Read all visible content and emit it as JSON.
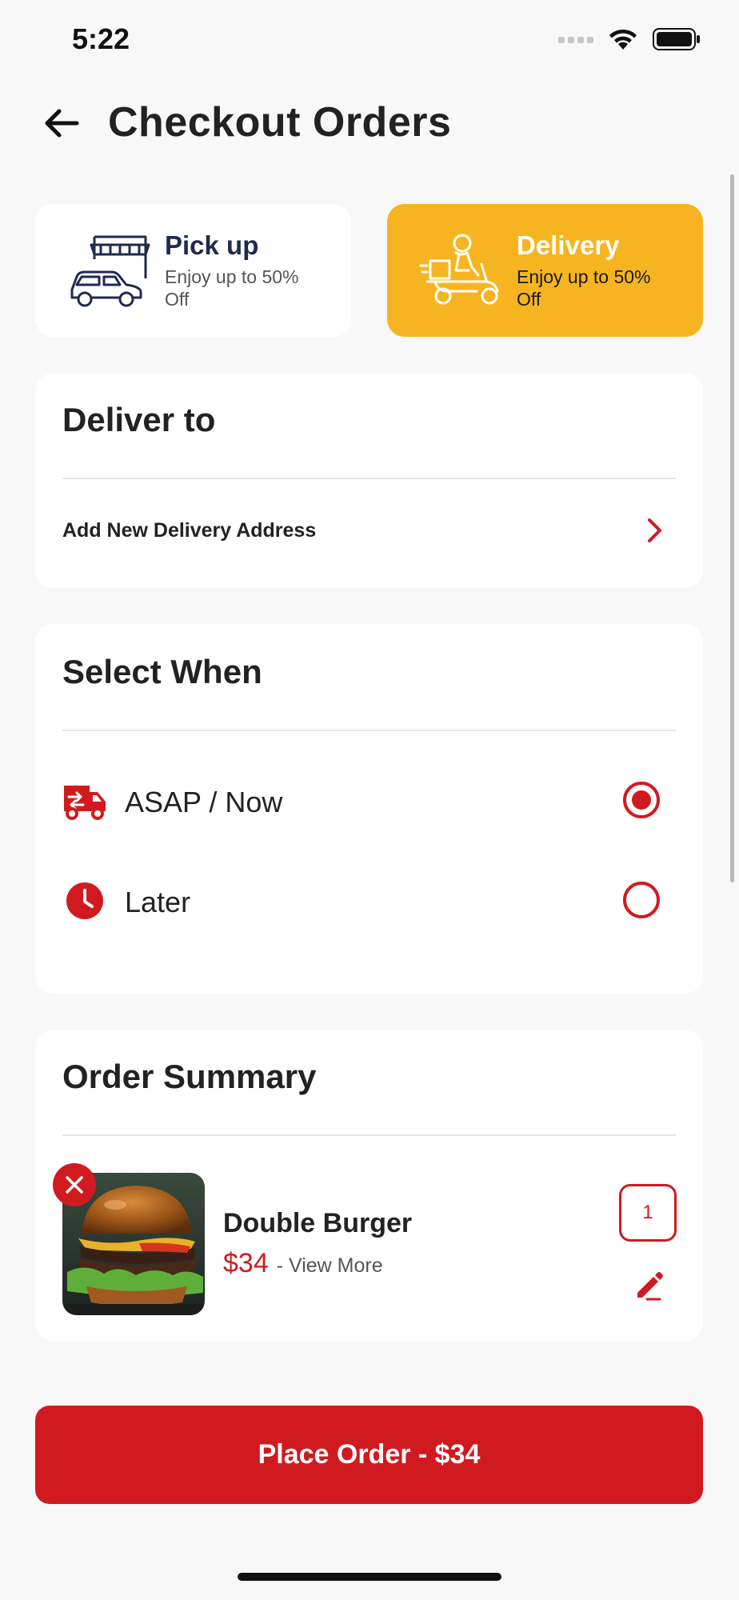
{
  "status_bar": {
    "time": "5:22",
    "icons": [
      "cellular-icon",
      "wifi-icon",
      "battery-icon"
    ]
  },
  "header": {
    "title": "Checkout Orders",
    "back_icon": "arrow-left-icon"
  },
  "order_modes": [
    {
      "title": "Pick up",
      "subtitle": "Enjoy up to 50% Off",
      "selected": false,
      "icon": "store-car-icon"
    },
    {
      "title": "Delivery",
      "subtitle": "Enjoy up to 50% Off",
      "selected": true,
      "icon": "delivery-scooter-icon"
    }
  ],
  "deliver_to": {
    "title": "Deliver to",
    "add_address_label": "Add New Delivery Address"
  },
  "select_when": {
    "title": "Select When",
    "options": [
      {
        "label": "ASAP / Now",
        "selected": true,
        "icon": "delivery-truck-icon"
      },
      {
        "label": "Later",
        "selected": false,
        "icon": "clock-icon"
      }
    ]
  },
  "order_summary": {
    "title": "Order Summary",
    "items": [
      {
        "name": "Double Burger",
        "price": "$34",
        "view_more": "- View More",
        "quantity": "1"
      }
    ]
  },
  "place_order": {
    "label": "Place Order - $34"
  },
  "colors": {
    "accent": "#d11a1f",
    "delivery_card": "#f6b520",
    "background": "#f8f8f8"
  }
}
